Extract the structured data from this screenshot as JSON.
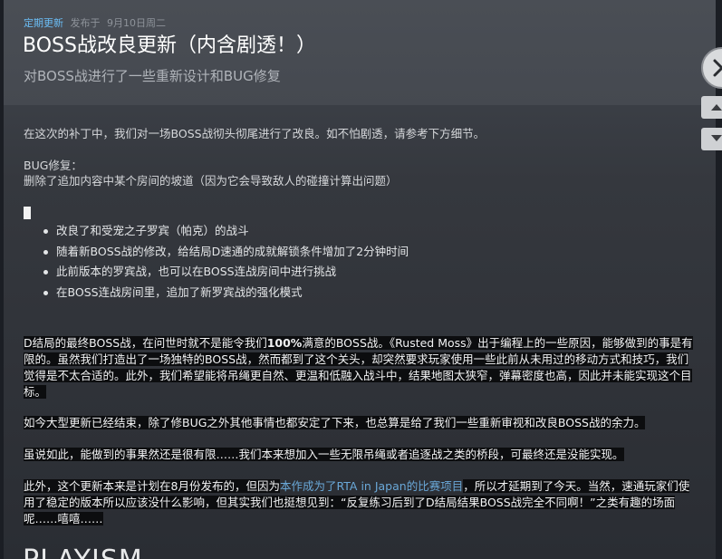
{
  "header": {
    "tag": "定期更新",
    "posted": "发布于",
    "date": "9月10日周二",
    "title": "BOSS战改良更新（内含剧透！）",
    "subtitle": "对BOSS战进行了一些重新设计和BUG修复"
  },
  "body": {
    "intro": "在这次的补丁中，我们对一场BOSS战彻头彻尾进行了改良。如不怕剧透，请参考下方细节。",
    "bug_heading": "BUG修复：",
    "bug_line": "删除了追加内容中某个房间的坡道（因为它会导致敌人的碰撞计算出问题）",
    "bullets": [
      "改良了和受宠之子罗宾（帕克）的战斗",
      "随着新BOSS战的修改，给结局D速通的成就解锁条件增加了2分钟时间",
      "此前版本的罗宾战，也可以在BOSS连战房间中进行挑战",
      "在BOSS连战房间里，追加了新罗宾战的强化模式"
    ],
    "para1_a": "D结局的最终BOSS战，在问世时就不是能令我们",
    "para1_bold": "100%",
    "para1_b": "满意的BOSS战。《Rusted Moss》出于编程上的一些原因，能够做到的事是有限的。虽然我们打造出了一场独特的BOSS战，然而都到了这个关头，却突然要求玩家使用一些此前从未用过的移动方式和技巧，我们觉得是不太合适的。此外，我们希望能将吊绳更自然、更温和低融入战斗中，结果地图太狭窄，弹幕密度也高，因此并未能实现这个目标。",
    "para2": "如今大型更新已经结束，除了修BUG之外其他事情也都安定了下来，也总算是给了我们一些重新审视和改良BOSS战的余力。",
    "para3": "虽说如此，能做到的事果然还是很有限……我们本来想加入一些无限吊绳或者追逐战之类的桥段，可最终还是没能实现。",
    "para4_a": "此外，这个更新本来是计划在8月份发布的，但因为",
    "para4_link1": "本作成为了",
    "para4_link2": "RTA in Japan",
    "para4_link3": "的比赛项目",
    "para4_b": "，所以才延期到了今天。当然，速通玩家们使用了稳定的版本所以应该没什么影响，但其实我们也挺想见到：“反复练习后到了D结局结果BOSS战完全不同啊！”之类有趣的场面呢……嘻嘻……",
    "next_heading": "PLAYISM"
  },
  "colors": {
    "tag": "#6bbdf5",
    "link": "#6aa8d8",
    "highlight": "#0c0d0f"
  },
  "icons": {
    "close": "close-icon",
    "prev": "chevron-up-icon",
    "next": "chevron-down-icon"
  }
}
